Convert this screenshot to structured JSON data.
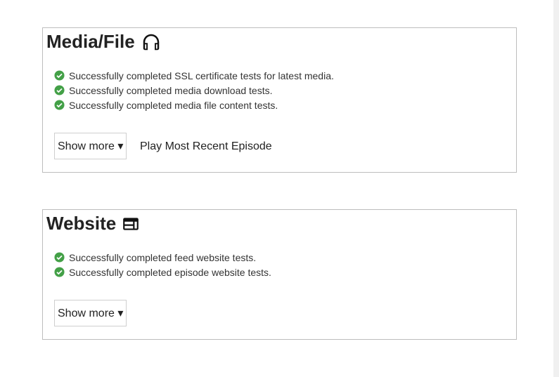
{
  "media": {
    "title": "Media/File",
    "icon": "headphones-icon",
    "checks": [
      "Successfully completed SSL certificate tests for latest media.",
      "Successfully completed media download tests.",
      "Successfully completed media file content tests."
    ],
    "show_more_label": "Show more ▾",
    "play_label": "Play Most Recent Episode"
  },
  "website": {
    "title": "Website",
    "icon": "browser-window-icon",
    "checks": [
      "Successfully completed feed website tests.",
      "Successfully completed episode website tests."
    ],
    "show_more_label": "Show more ▾"
  },
  "colors": {
    "success": "#43a047",
    "border": "#bdbdbd"
  }
}
